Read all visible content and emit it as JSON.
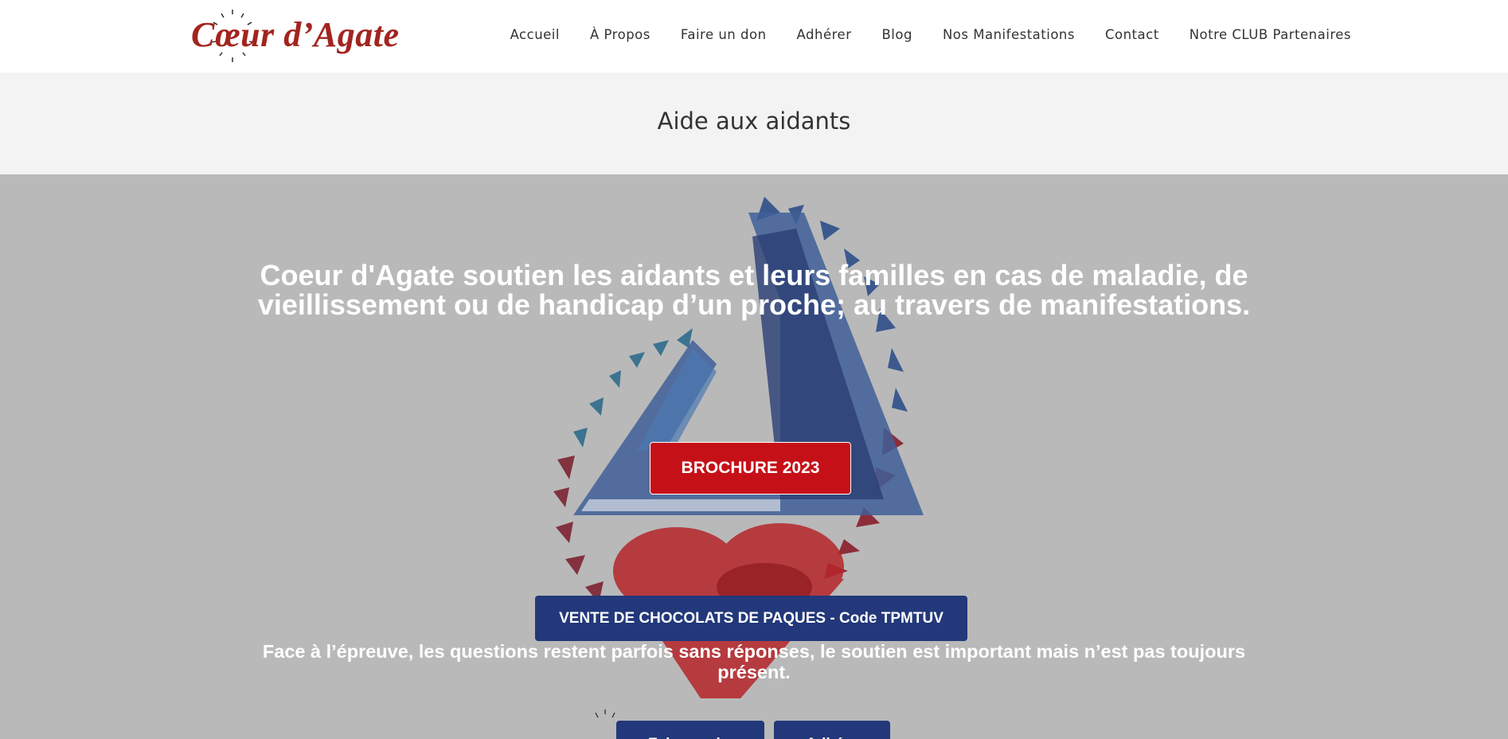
{
  "brand": {
    "logo_text": "Cœur d’Agate",
    "logo_color": "#a3241f"
  },
  "nav": {
    "items": [
      {
        "label": "Accueil"
      },
      {
        "label": "À Propos"
      },
      {
        "label": "Faire un don"
      },
      {
        "label": "Adhérer"
      },
      {
        "label": "Blog"
      },
      {
        "label": "Nos Manifestations"
      },
      {
        "label": "Contact"
      },
      {
        "label": "Notre CLUB Partenaires"
      }
    ]
  },
  "page": {
    "title": "Aide aux aidants"
  },
  "hero": {
    "heading": "Coeur d'Agate soutien les aidants et leurs familles en cas de maladie, de vieillissement ou de handicap d’un proche; au travers de manifestations.",
    "brochure_label": "BROCHURE 2023",
    "chocolats_label": "VENTE DE CHOCOLATS DE PAQUES - Code TPMTUV",
    "subtext": "Face à l’épreuve, les questions restent parfois sans réponses, le soutien est important mais n’est pas toujours présent.",
    "don_label": "Faire un don",
    "adherer_label": "Adhérer"
  },
  "colors": {
    "hero_bg": "#b9b9b9",
    "title_band_bg": "#f3f3f3",
    "brochure_red": "#c61018",
    "navy": "#22387a"
  },
  "icons": [
    "heart-logo-icon",
    "shattered-heart-artwork",
    "hands-heart-artwork"
  ]
}
